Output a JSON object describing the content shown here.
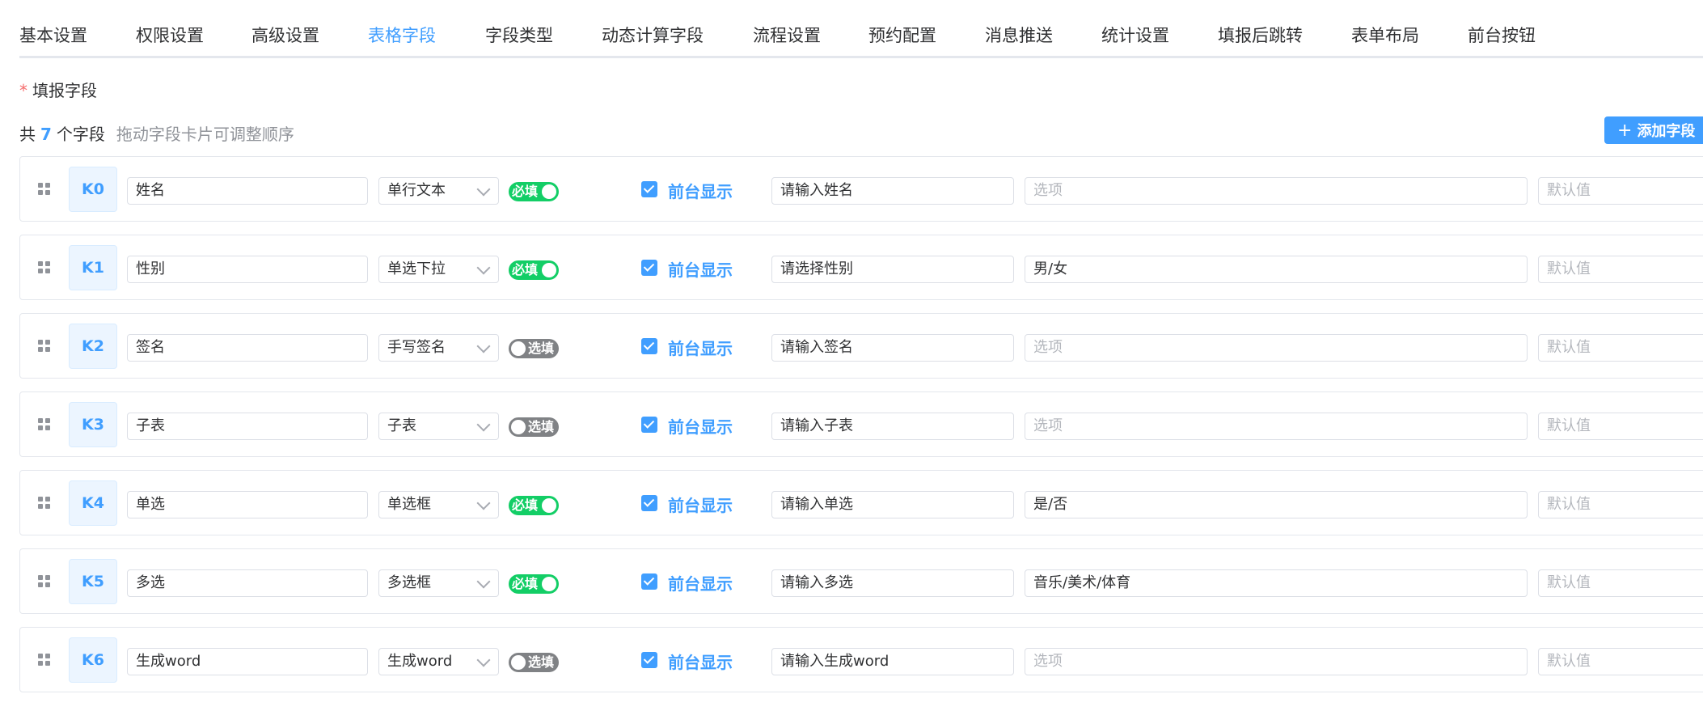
{
  "tabs": [
    {
      "label": "基本设置",
      "active": false
    },
    {
      "label": "权限设置",
      "active": false
    },
    {
      "label": "高级设置",
      "active": false
    },
    {
      "label": "表格字段",
      "active": true
    },
    {
      "label": "字段类型",
      "active": false
    },
    {
      "label": "动态计算字段",
      "active": false
    },
    {
      "label": "流程设置",
      "active": false
    },
    {
      "label": "预约配置",
      "active": false
    },
    {
      "label": "消息推送",
      "active": false
    },
    {
      "label": "统计设置",
      "active": false
    },
    {
      "label": "填报后跳转",
      "active": false
    },
    {
      "label": "表单布局",
      "active": false
    },
    {
      "label": "前台按钮",
      "active": false
    }
  ],
  "section": {
    "required_mark": "*",
    "label": "填报字段"
  },
  "summary": {
    "prefix": "共",
    "count": "7",
    "suffix": "个字段",
    "hint": "拖动字段卡片可调整顺序"
  },
  "add_button": {
    "icon": "plus-icon",
    "label": "添加字段"
  },
  "option_placeholder": "选项",
  "default_placeholder": "默认值",
  "fields": [
    {
      "key": "K0",
      "name": "姓名",
      "type": "单行文本",
      "required": true,
      "required_label": "必填",
      "show_label": "前台显示",
      "show": true,
      "placeholder": "请输入姓名",
      "options": ""
    },
    {
      "key": "K1",
      "name": "性别",
      "type": "单选下拉",
      "required": true,
      "required_label": "必填",
      "show_label": "前台显示",
      "show": true,
      "placeholder": "请选择性别",
      "options": "男/女"
    },
    {
      "key": "K2",
      "name": "签名",
      "type": "手写签名",
      "required": false,
      "required_label": "选填",
      "show_label": "前台显示",
      "show": true,
      "placeholder": "请输入签名",
      "options": ""
    },
    {
      "key": "K3",
      "name": "子表",
      "type": "子表",
      "required": false,
      "required_label": "选填",
      "show_label": "前台显示",
      "show": true,
      "placeholder": "请输入子表",
      "options": ""
    },
    {
      "key": "K4",
      "name": "单选",
      "type": "单选框",
      "required": true,
      "required_label": "必填",
      "show_label": "前台显示",
      "show": true,
      "placeholder": "请输入单选",
      "options": "是/否"
    },
    {
      "key": "K5",
      "name": "多选",
      "type": "多选框",
      "required": true,
      "required_label": "必填",
      "show_label": "前台显示",
      "show": true,
      "placeholder": "请输入多选",
      "options": "音乐/美术/体育"
    },
    {
      "key": "K6",
      "name": "生成word",
      "type": "生成word",
      "required": false,
      "required_label": "选填",
      "show_label": "前台显示",
      "show": true,
      "placeholder": "请输入生成word",
      "options": ""
    }
  ],
  "colors": {
    "accent": "#409eff",
    "switch_on": "#13ce66",
    "switch_off": "#808285",
    "required_star": "#f56c6c"
  }
}
